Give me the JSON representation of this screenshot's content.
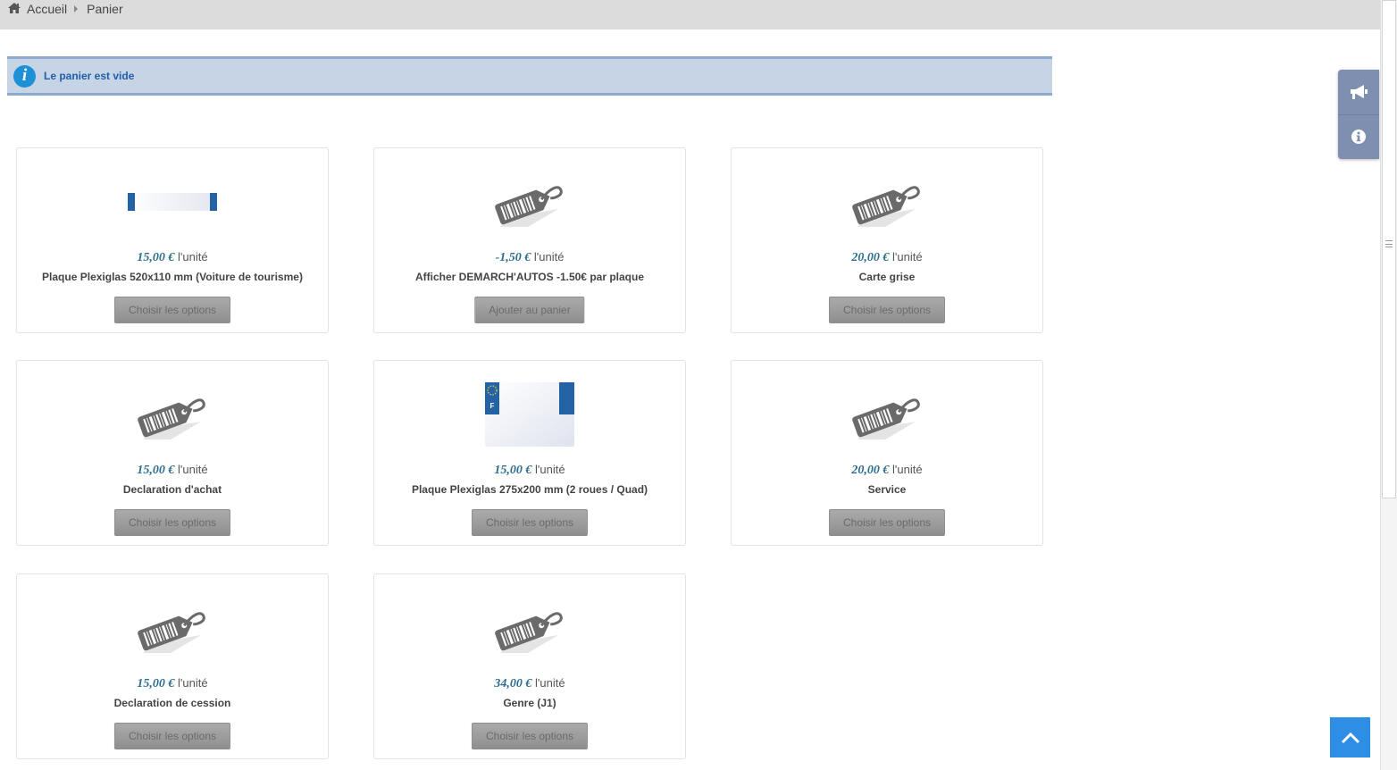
{
  "breadcrumb": {
    "items": [
      "Accueil",
      "Panier"
    ]
  },
  "alert": {
    "text": "Le panier est vide",
    "icon_glyph": "i"
  },
  "unit_suffix": "l'unité",
  "products": [
    {
      "price": "15,00 €",
      "title": "Plaque Plexiglas 520x110 mm (Voiture de tourisme)",
      "button": "Choisir les options",
      "image": "long-plate-icon"
    },
    {
      "price": "-1,50 €",
      "title": "Afficher DEMARCH'AUTOS -1.50€ par plaque",
      "button": "Ajouter au panier",
      "image": "price-tag-icon"
    },
    {
      "price": "20,00 €",
      "title": "Carte grise",
      "button": "Choisir les options",
      "image": "price-tag-icon"
    },
    {
      "price": "15,00 €",
      "title": "Declaration d'achat",
      "button": "Choisir les options",
      "image": "price-tag-icon"
    },
    {
      "price": "15,00 €",
      "title": "Plaque Plexiglas 275x200 mm (2 roues / Quad)",
      "button": "Choisir les options",
      "image": "square-plate-icon"
    },
    {
      "price": "20,00 €",
      "title": "Service",
      "button": "Choisir les options",
      "image": "price-tag-icon"
    },
    {
      "price": "15,00 €",
      "title": "Declaration de cession",
      "button": "Choisir les options",
      "image": "price-tag-icon"
    },
    {
      "price": "34,00 €",
      "title": "Genre (J1)",
      "button": "Choisir les options",
      "image": "price-tag-icon"
    }
  ],
  "colors": {
    "accent": "#2e8de4",
    "price": "#2f6e8f",
    "alert_bg": "#c6d4e6",
    "alert_text": "#1f5fa8",
    "side_panel": "#7e8fb0"
  },
  "side_panel": {
    "icons": [
      "megaphone-icon",
      "info-icon"
    ]
  },
  "back_to_top": {
    "icon": "chevron-up-icon"
  }
}
